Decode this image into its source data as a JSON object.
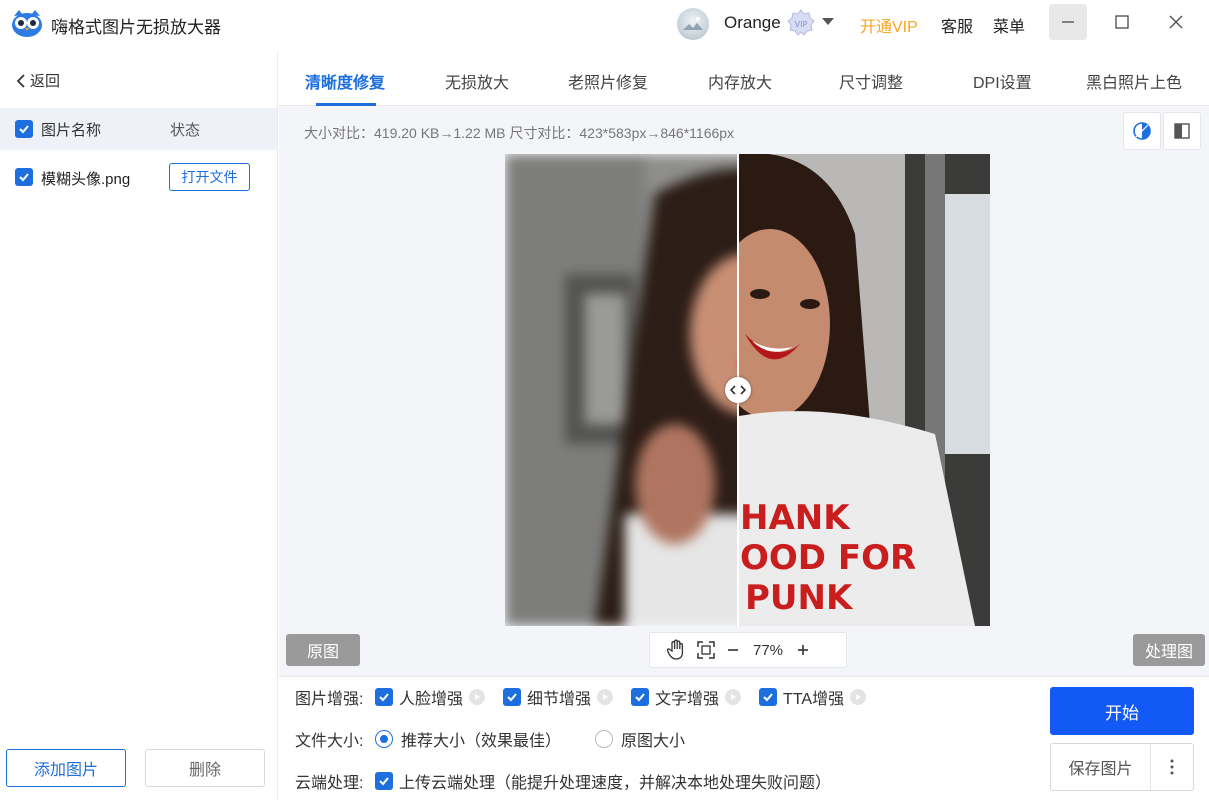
{
  "app": {
    "title": "嗨格式图片无损放大器",
    "user_name": "Orange",
    "vip_label": "开通VIP",
    "service_label": "客服",
    "menu_label": "菜单",
    "accent_color": "#1e6fde",
    "vip_color": "#f5a623"
  },
  "sidebar": {
    "back_label": "返回",
    "header": {
      "name_label": "图片名称",
      "status_label": "状态",
      "checked": true
    },
    "files": [
      {
        "name": "模糊头像.png",
        "action_label": "打开文件",
        "checked": true
      }
    ],
    "add_label": "添加图片",
    "delete_label": "删除"
  },
  "tabs": [
    {
      "label": "清晰度修复",
      "active": true
    },
    {
      "label": "无损放大",
      "active": false
    },
    {
      "label": "老照片修复",
      "active": false
    },
    {
      "label": "内存放大",
      "active": false
    },
    {
      "label": "尺寸调整",
      "active": false
    },
    {
      "label": "DPI设置",
      "active": false
    },
    {
      "label": "黑白照片上色",
      "active": false
    }
  ],
  "info": {
    "text": "大小对比：419.20 KB→1.22 MB   尺寸对比：423*583px→846*1166px"
  },
  "preview": {
    "image_text": "HANK\nOOD FOR\nPUNK",
    "original_label": "原图",
    "processed_label": "处理图",
    "zoom": "77%",
    "icons": [
      "hand-icon",
      "fit-screen-icon",
      "zoom-out-icon",
      "zoom-in-icon"
    ]
  },
  "settings": {
    "enhance": {
      "label": "图片增强:",
      "options": [
        {
          "label": "人脸增强",
          "checked": true
        },
        {
          "label": "细节增强",
          "checked": true
        },
        {
          "label": "文字增强",
          "checked": true
        },
        {
          "label": "TTA增强",
          "checked": true
        }
      ]
    },
    "filesize": {
      "label": "文件大小:",
      "options": [
        {
          "label": "推荐大小（效果最佳）",
          "selected": true
        },
        {
          "label": "原图大小",
          "selected": false
        }
      ]
    },
    "cloud": {
      "label": "云端处理:",
      "option": {
        "label": "上传云端处理（能提升处理速度，并解决本地处理失败问题）",
        "checked": true
      }
    }
  },
  "actions": {
    "start_label": "开始",
    "save_label": "保存图片",
    "start_color": "#1259f5"
  }
}
